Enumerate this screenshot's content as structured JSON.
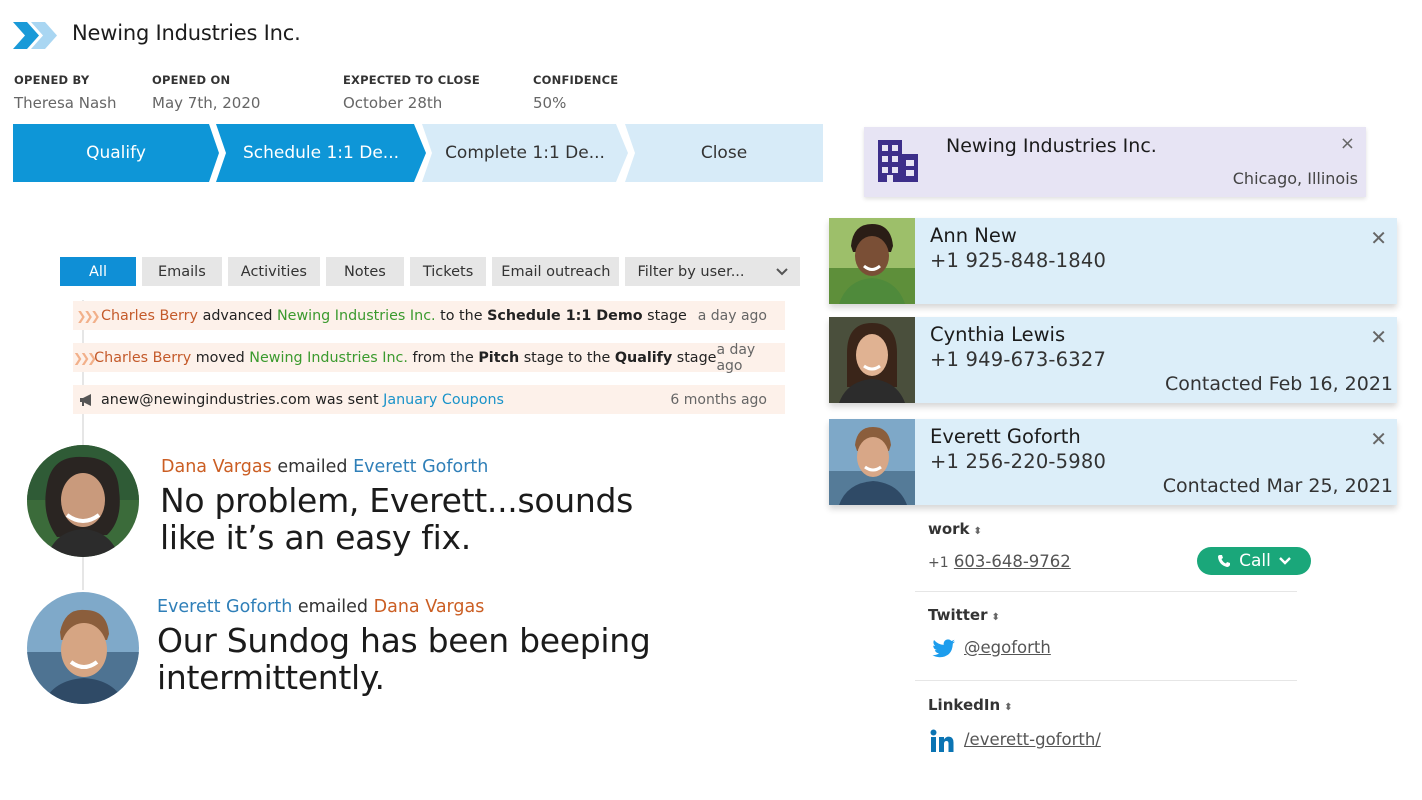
{
  "deal": {
    "title": "Newing Industries Inc.",
    "meta": [
      {
        "label": "OPENED BY",
        "value": "Theresa Nash"
      },
      {
        "label": "OPENED ON",
        "value": "May 7th, 2020"
      },
      {
        "label": "EXPECTED TO CLOSE",
        "value": "October 28th"
      },
      {
        "label": "CONFIDENCE",
        "value": "50%"
      }
    ]
  },
  "pipeline": {
    "stages": [
      "Qualify",
      "Schedule 1:1 De...",
      "Complete 1:1 De...",
      "Close"
    ],
    "colors": {
      "active": "#0e96d7",
      "inactive": "#d7ebf8"
    }
  },
  "tabs": {
    "items": [
      "All",
      "Emails",
      "Activities",
      "Notes",
      "Tickets",
      "Email outreach"
    ],
    "filter_label": "Filter by user..."
  },
  "feed": [
    {
      "actor": "Charles Berry",
      "verb": "advanced",
      "company": "Newing Industries Inc.",
      "mid": "to the",
      "stage": "Schedule 1:1 Demo",
      "tail": "stage",
      "time": "a day ago"
    },
    {
      "actor": "Charles Berry",
      "verb": "moved",
      "company": "Newing Industries Inc.",
      "mid": "from the",
      "stage": "Pitch",
      "mid2": "stage to the",
      "stage2": "Qualify",
      "tail": "stage",
      "time": "a day ago"
    },
    {
      "email": "anew@newingindustries.com",
      "verb": "was sent",
      "campaign": "January Coupons",
      "time": "6 months ago"
    }
  ],
  "emails": [
    {
      "from": "Dana Vargas",
      "verb": "emailed",
      "to": "Everett Goforth",
      "body_line1": "No problem, Everett...sounds",
      "body_line2": "like it’s an easy fix."
    },
    {
      "from": "Everett Goforth",
      "verb": "emailed",
      "to": "Dana Vargas",
      "body_line1": "Our Sundog has been beeping",
      "body_line2": "intermittently."
    }
  ],
  "account": {
    "name": "Newing Industries Inc.",
    "location": "Chicago, Illinois",
    "close": "×"
  },
  "contacts": [
    {
      "name": "Ann New",
      "phone": "+1 925-848-1840",
      "contacted": ""
    },
    {
      "name": "Cynthia Lewis",
      "phone": "+1 949-673-6327",
      "contacted": "Contacted Feb 16, 2021"
    },
    {
      "name": "Everett Goforth",
      "phone": "+1 256-220-5980",
      "contacted": "Contacted Mar 25, 2021"
    }
  ],
  "details": {
    "work_label": "work",
    "work_prefix": "+1",
    "work_number": "603-648-9762",
    "call_label": "Call",
    "twitter_label": "Twitter",
    "twitter_handle": "@egoforth",
    "linkedin_label": "LinkedIn",
    "linkedin_path": "/everett-goforth/"
  }
}
